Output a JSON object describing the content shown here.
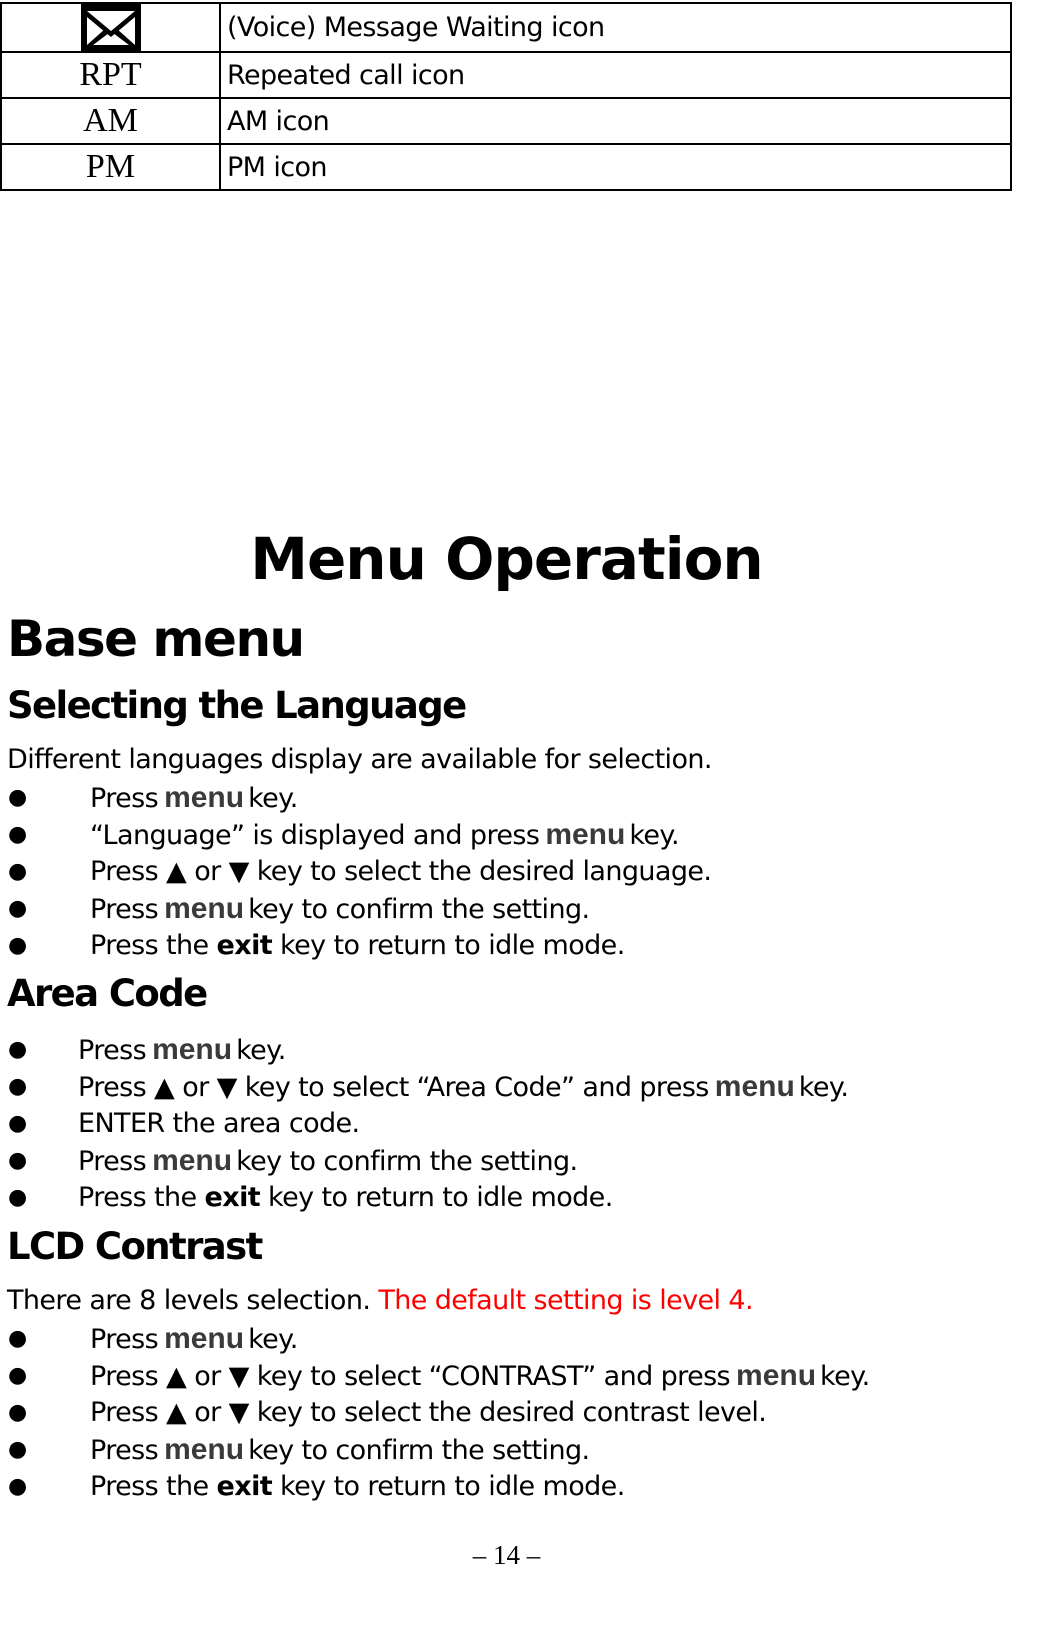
{
  "icon_table": {
    "rows": [
      {
        "symbol": "",
        "icon": "envelope-icon",
        "description": "(Voice) Message Waiting icon"
      },
      {
        "symbol": "RPT",
        "description": "Repeated call icon"
      },
      {
        "symbol": "AM",
        "description": "AM icon"
      },
      {
        "symbol": "PM",
        "description": "PM icon"
      }
    ]
  },
  "page_title": "Menu Operation",
  "section_title": "Base menu",
  "language": {
    "heading": "Selecting the Language",
    "intro": "Different languages display are available for selection.",
    "steps": [
      {
        "pre": "Press",
        "key": "menu",
        "post": "key."
      },
      {
        "pre": "“Language” is displayed and press",
        "key": "menu",
        "post": "key."
      },
      {
        "pre": "Press ▲ or ▼ key to select the desired language.",
        "key": "",
        "post": ""
      },
      {
        "pre": "Press",
        "key": "menu",
        "post": "key to confirm the setting."
      },
      {
        "pre": "Press the",
        "bold": "exit",
        "post": "key to return to idle mode."
      }
    ]
  },
  "area_code": {
    "heading": "Area Code",
    "steps": [
      {
        "pre": "Press",
        "key": "menu",
        "post": "key."
      },
      {
        "pre": "Press ▲ or ▼ key to select “Area Code” and press",
        "key": "menu",
        "post": "key."
      },
      {
        "pre": "ENTER the area code.",
        "key": "",
        "post": ""
      },
      {
        "pre": "Press",
        "key": "menu",
        "post": "key to confirm the setting."
      },
      {
        "pre": "Press the",
        "bold": "exit",
        "post": "key to return to idle mode."
      }
    ]
  },
  "lcd_contrast": {
    "heading": "LCD Contrast",
    "intro": "There are 8 levels selection.",
    "intro_highlight": "The default setting is level 4.",
    "highlight_color": "#ff0000",
    "steps": [
      {
        "pre": "Press",
        "key": "menu",
        "post": "key."
      },
      {
        "pre": "Press ▲ or ▼ key to select “CONTRAST” and press",
        "key": "menu",
        "post": "key."
      },
      {
        "pre": "Press ▲ or ▼ key to select the desired contrast level.",
        "key": "",
        "post": ""
      },
      {
        "pre": "Press",
        "key": "menu",
        "post": "key to confirm the setting."
      },
      {
        "pre": "Press the",
        "bold": "exit",
        "post": "key to return to idle mode."
      }
    ]
  },
  "bullet_glyph": "●",
  "page_number": "– 14 –"
}
